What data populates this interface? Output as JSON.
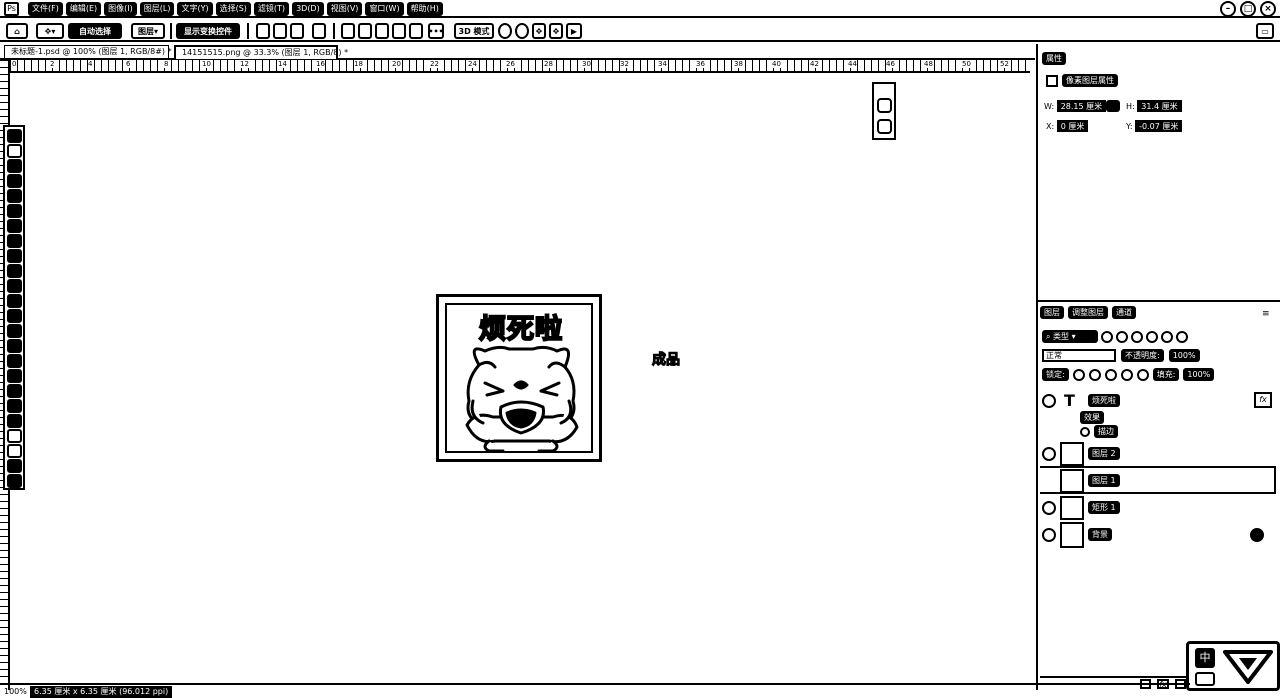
{
  "menubar": {
    "items": [
      "文件(F)",
      "编辑(E)",
      "图像(I)",
      "图层(L)",
      "文字(Y)",
      "选择(S)",
      "滤镜(T)",
      "3D(D)",
      "视图(V)",
      "窗口(W)",
      "帮助(H)"
    ]
  },
  "options": {
    "auto_select_label": "自动选择",
    "auto_select_target": "图层",
    "show_transform_label": "显示变换控件",
    "mode_3d_label": "3D 模式"
  },
  "tabs": [
    {
      "label": "未标题-1.psd @ 100% (图层 1, RGB/8#) *",
      "active": false
    },
    {
      "label": "14151515.png @ 33.3% (图层 1, RGB/8) *",
      "active": true
    }
  ],
  "ruler": {
    "h_numbers": [
      "0",
      "2",
      "4",
      "6",
      "8",
      "10",
      "12",
      "14",
      "16",
      "18",
      "20",
      "22",
      "24",
      "26",
      "28",
      "30",
      "32",
      "34",
      "36",
      "38",
      "40",
      "42",
      "44",
      "46",
      "48",
      "50",
      "52"
    ]
  },
  "canvas": {
    "artwork_title": "烦死啦",
    "done_label": "成品"
  },
  "properties": {
    "tab_label": "属性",
    "section_title": "像素图层属性",
    "w_label": "W:",
    "w_value": "28.15 厘米",
    "h_label": "H:",
    "h_value": "31.4 厘米",
    "x_label": "X:",
    "x_value": "0 厘米",
    "y_label": "Y:",
    "y_value": "-0.07 厘米"
  },
  "layers": {
    "tabs": [
      "图层",
      "调整图层",
      "通道"
    ],
    "filter_label": "类型",
    "blend_mode": "正常",
    "opacity_label": "不透明度:",
    "opacity_value": "100%",
    "lock_label": "锁定:",
    "fill_label": "填充:",
    "fill_value": "100%",
    "items": [
      {
        "name": "烦死啦",
        "kind": "text"
      },
      {
        "name": "效果",
        "kind": "fx"
      },
      {
        "name": "描边",
        "kind": "fx-item"
      },
      {
        "name": "图层 2",
        "kind": "pixel"
      },
      {
        "name": "图层 1",
        "kind": "pixel"
      },
      {
        "name": "矩形 1",
        "kind": "shape"
      },
      {
        "name": "背景",
        "kind": "background"
      }
    ],
    "fx_badge": "fx"
  },
  "status": {
    "zoom": "100%",
    "doc_info": "6.35 厘米 x 6.35 厘米 (96.012 ppi)"
  },
  "ime": {
    "label": "中"
  }
}
